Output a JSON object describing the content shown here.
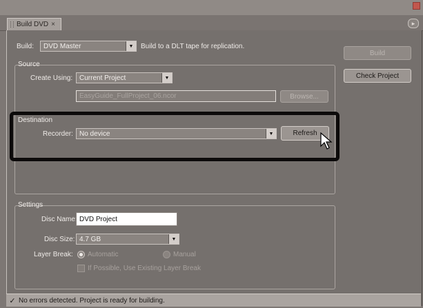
{
  "tab": {
    "title": "Build DVD",
    "close": "×"
  },
  "panel_menu": "▸",
  "build": {
    "label": "Build:",
    "value": "DVD Master",
    "description": "Build to a DLT tape for replication."
  },
  "actions": {
    "build_label": "Build",
    "check_label": "Check Project"
  },
  "source": {
    "title": "Source",
    "create_using_label": "Create Using:",
    "create_using_value": "Current Project",
    "path": "EasyGuide_FullProject_06.ncor",
    "browse_label": "Browse..."
  },
  "destination": {
    "title": "Destination",
    "recorder_label": "Recorder:",
    "recorder_value": "No device",
    "refresh_label": "Refresh"
  },
  "settings": {
    "title": "Settings",
    "disc_name_label": "Disc Name:",
    "disc_name_value": "DVD Project",
    "disc_size_label": "Disc Size:",
    "disc_size_value": "4.7 GB",
    "layer_break_label": "Layer Break:",
    "layer_break_automatic": "Automatic",
    "layer_break_manual": "Manual",
    "use_existing_label": "If Possible, Use Existing Layer Break",
    "layer_break_selected": "Automatic"
  },
  "status": {
    "icon": "checkmark-icon",
    "message": "No errors detected. Project is ready for building."
  }
}
